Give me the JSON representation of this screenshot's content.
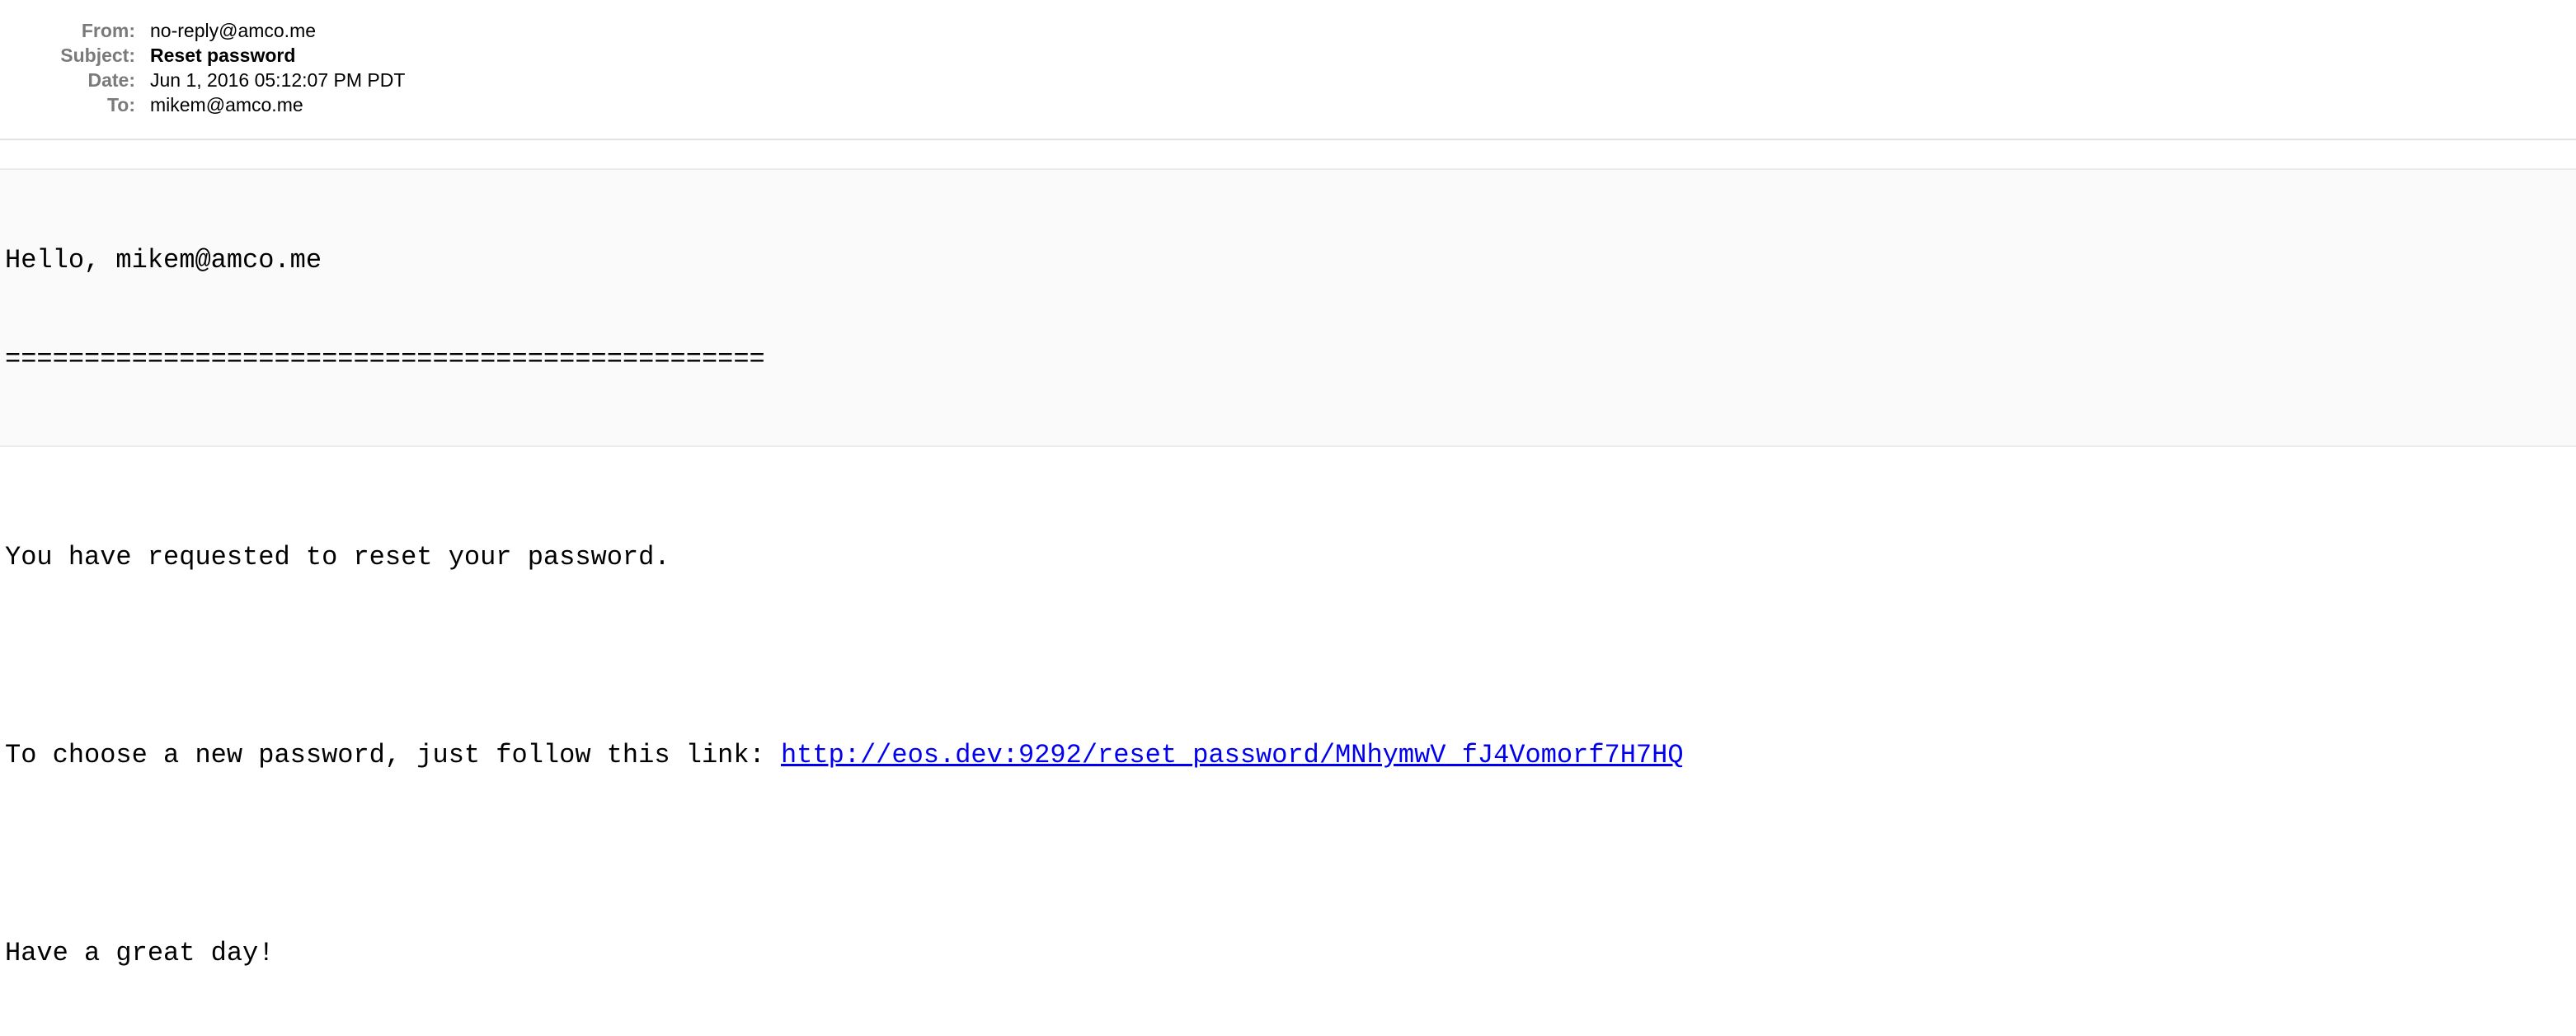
{
  "headers": {
    "from_label": "From:",
    "from_value": "no-reply@amco.me",
    "subject_label": "Subject:",
    "subject_value": "Reset password",
    "date_label": "Date:",
    "date_value": "Jun 1, 2016 05:12:07 PM PDT",
    "to_label": "To:",
    "to_value": "mikem@amco.me"
  },
  "body": {
    "greeting": "Hello, mikem@amco.me",
    "underline": "================================================",
    "request_line": "You have requested to reset your password.",
    "link_prefix": "To choose a new password, just follow this link: ",
    "link_text": "http://eos.dev:9292/reset_password/MNhymwV_fJ4Vomorf7H7HQ",
    "closing": "Have a great day!"
  },
  "colors": {
    "label": "#7a7a7a",
    "link": "#0000ee",
    "body_background": "#fafafa"
  }
}
